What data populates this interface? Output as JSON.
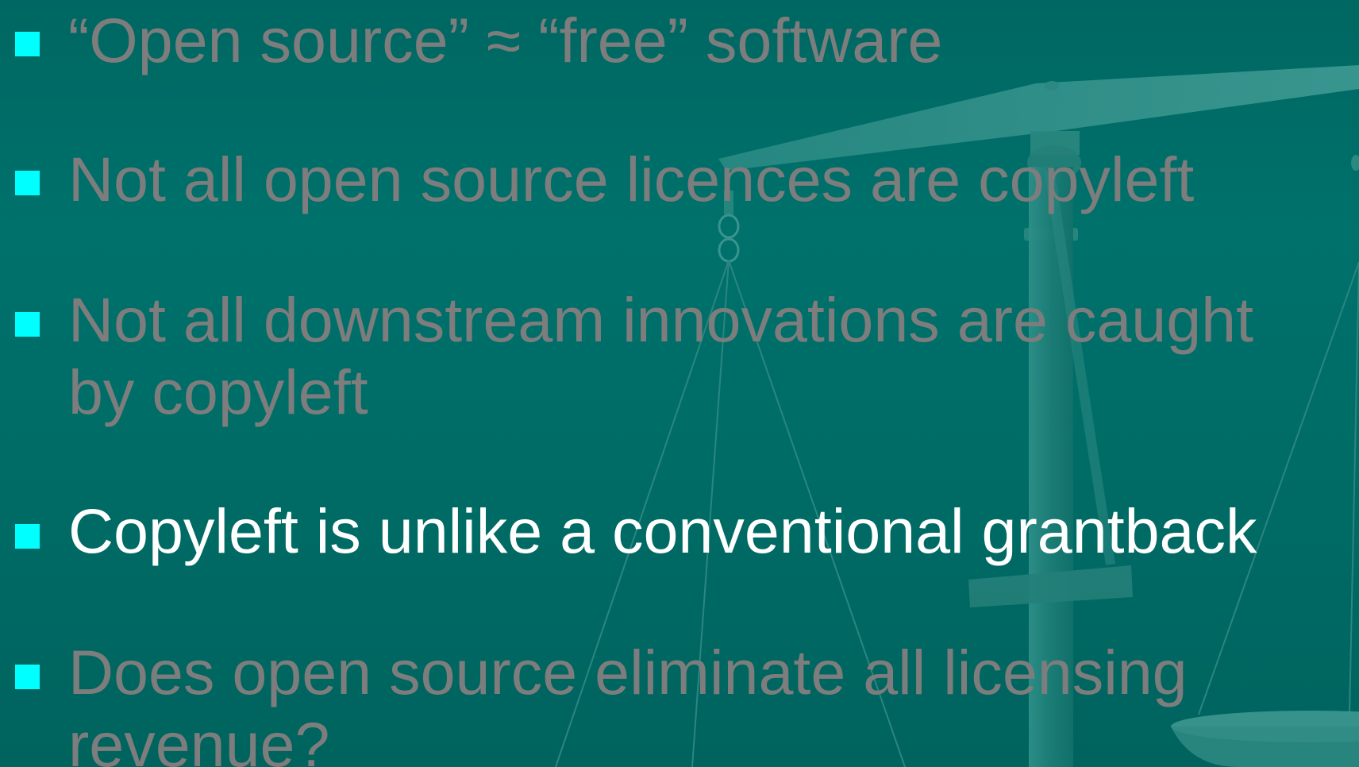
{
  "slide": {
    "bullets": [
      {
        "text": "“Open source” ≈ “free” software",
        "highlighted": false
      },
      {
        "text": "Not all open source licences are copyleft",
        "highlighted": false
      },
      {
        "line1": "Not all downstream innovations are caught",
        "line2": "by copyleft",
        "highlighted": false
      },
      {
        "text": "Copyleft is unlike a conventional grantback",
        "highlighted": true
      },
      {
        "line1": "Does open source eliminate all licensing",
        "line2": "revenue?",
        "highlighted": false
      }
    ],
    "colors": {
      "background": "#006c66",
      "bullet_marker": "#00ffff",
      "dimmed_text": "#7d7d7d",
      "active_text": "#ffffff"
    },
    "background_image": "balance-scales-icon"
  }
}
